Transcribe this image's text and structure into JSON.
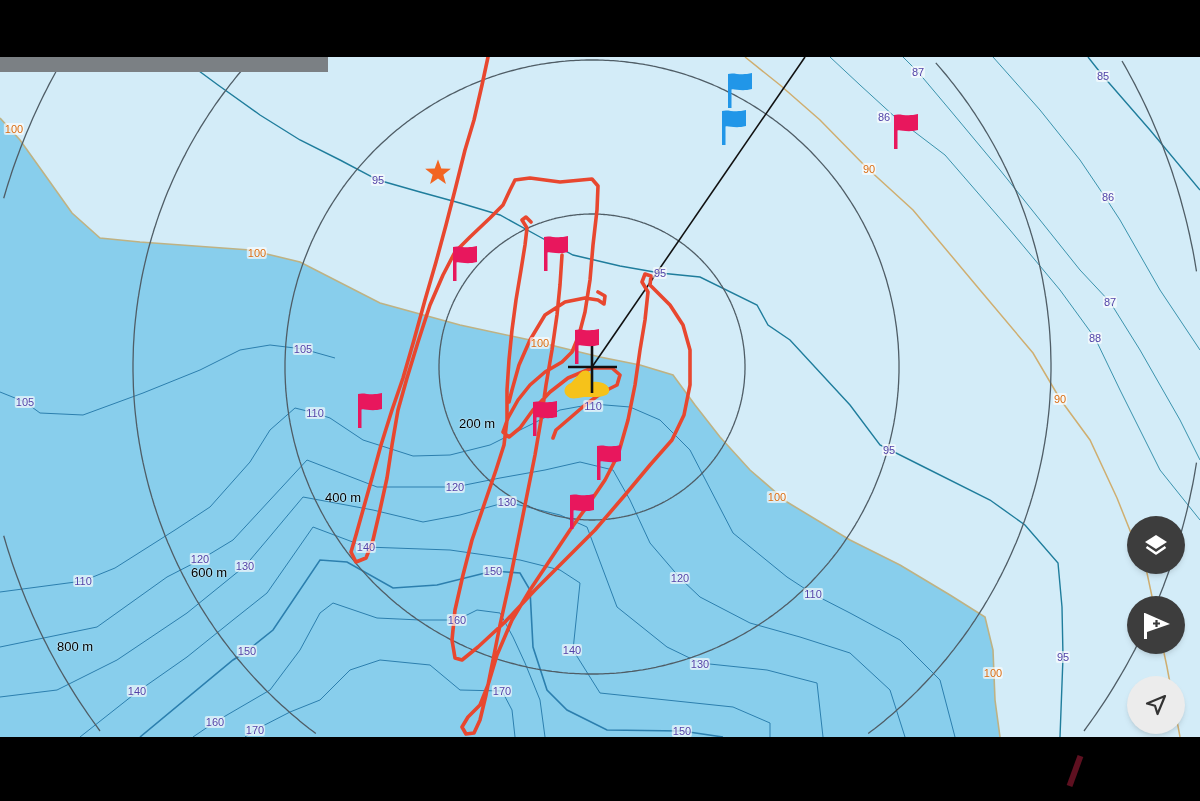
{
  "map": {
    "contour_labels": [
      {
        "text": "100",
        "kind": "major"
      },
      {
        "text": "95",
        "kind": "minor"
      },
      {
        "text": "87",
        "kind": "minor"
      },
      {
        "text": "85",
        "kind": "minor"
      },
      {
        "text": "86",
        "kind": "minor"
      },
      {
        "text": "90",
        "kind": "major"
      },
      {
        "text": "86",
        "kind": "minor"
      },
      {
        "text": "100",
        "kind": "major"
      },
      {
        "text": "95",
        "kind": "minor"
      },
      {
        "text": "87",
        "kind": "minor"
      },
      {
        "text": "88",
        "kind": "minor"
      },
      {
        "text": "100",
        "kind": "major"
      },
      {
        "text": "105",
        "kind": "minor"
      },
      {
        "text": "90",
        "kind": "major"
      },
      {
        "text": "105",
        "kind": "minor"
      },
      {
        "text": "110",
        "kind": "minor"
      },
      {
        "text": "110",
        "kind": "minor"
      },
      {
        "text": "95",
        "kind": "minor"
      },
      {
        "text": "120",
        "kind": "minor"
      },
      {
        "text": "100",
        "kind": "major"
      },
      {
        "text": "130",
        "kind": "minor"
      },
      {
        "text": "140",
        "kind": "minor"
      },
      {
        "text": "120",
        "kind": "minor"
      },
      {
        "text": "130",
        "kind": "minor"
      },
      {
        "text": "150",
        "kind": "minor"
      },
      {
        "text": "120",
        "kind": "minor"
      },
      {
        "text": "110",
        "kind": "minor"
      },
      {
        "text": "110",
        "kind": "minor"
      },
      {
        "text": "160",
        "kind": "minor"
      },
      {
        "text": "140",
        "kind": "minor"
      },
      {
        "text": "150",
        "kind": "minor"
      },
      {
        "text": "95",
        "kind": "minor"
      },
      {
        "text": "130",
        "kind": "minor"
      },
      {
        "text": "100",
        "kind": "major"
      },
      {
        "text": "140",
        "kind": "minor"
      },
      {
        "text": "170",
        "kind": "minor"
      },
      {
        "text": "160",
        "kind": "minor"
      },
      {
        "text": "170",
        "kind": "minor"
      },
      {
        "text": "150",
        "kind": "minor"
      }
    ],
    "range_rings": [
      {
        "label": "200 m"
      },
      {
        "label": "400 m"
      },
      {
        "label": "600 m"
      },
      {
        "label": "800 m"
      }
    ],
    "flags": [
      {
        "color": "#2196e8"
      },
      {
        "color": "#2196e8"
      },
      {
        "color": "#e8175d"
      },
      {
        "color": "#e8175d"
      },
      {
        "color": "#e8175d"
      },
      {
        "color": "#e8175d"
      },
      {
        "color": "#e8175d"
      },
      {
        "color": "#e8175d"
      },
      {
        "color": "#e8175d"
      },
      {
        "color": "#e8175d"
      }
    ]
  },
  "map_buttons": [
    {
      "kind": "layers"
    },
    {
      "kind": "add_flag"
    },
    {
      "kind": "locate"
    }
  ]
}
